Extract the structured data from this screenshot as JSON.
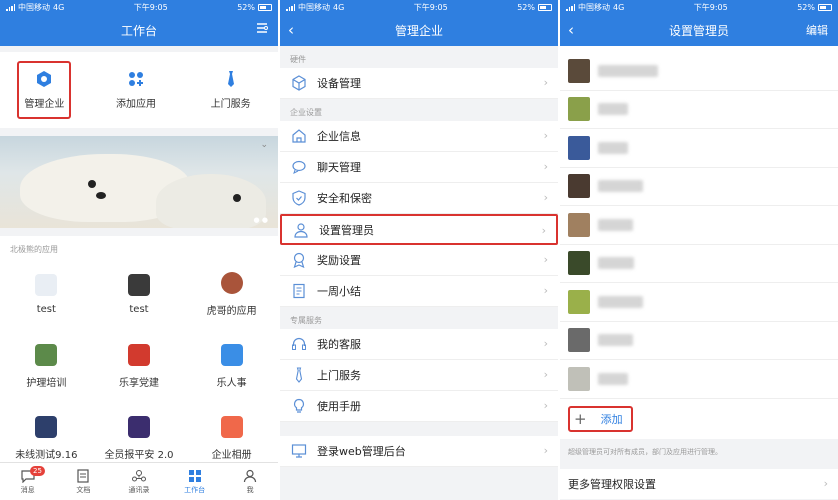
{
  "status": {
    "carrier": "中国移动",
    "network": "4G",
    "time": "下午9:05",
    "battery": "52%"
  },
  "panel1": {
    "title": "工作台",
    "shortcuts": [
      {
        "label": "管理企业",
        "icon": "hexagon-icon"
      },
      {
        "label": "添加应用",
        "icon": "apps-grid-icon"
      },
      {
        "label": "上门服务",
        "icon": "tie-icon"
      }
    ],
    "apps_section_title": "北极熊的应用",
    "apps": [
      {
        "label": "test",
        "color": "#e9eef4"
      },
      {
        "label": "test",
        "color": "#3a3a3a"
      },
      {
        "label": "虎哥的应用",
        "color": "#a9543a"
      },
      {
        "label": "护理培训",
        "color": "#5c8a4a"
      },
      {
        "label": "乐享党建",
        "color": "#d23a2e"
      },
      {
        "label": "乐人事",
        "color": "#3a8ee6"
      },
      {
        "label": "未线测试9.16",
        "color": "#2d3f6b"
      },
      {
        "label": "全员报平安 2.0",
        "color": "#3b2d6e"
      },
      {
        "label": "企业相册",
        "color": "#f0684a"
      }
    ],
    "tabs": [
      {
        "label": "消息",
        "icon": "chat-bubble-icon",
        "badge": "25"
      },
      {
        "label": "文档",
        "icon": "document-icon"
      },
      {
        "label": "通讯录",
        "icon": "contacts-icon"
      },
      {
        "label": "工作台",
        "icon": "workbench-grid-icon",
        "active": true
      },
      {
        "label": "我",
        "icon": "person-icon"
      }
    ]
  },
  "panel2": {
    "title": "管理企业",
    "sections": [
      {
        "title": "硬件",
        "rows": [
          {
            "label": "设备管理",
            "icon": "cube-icon"
          }
        ]
      },
      {
        "title": "企业设置",
        "rows": [
          {
            "label": "企业信息",
            "icon": "home-icon"
          },
          {
            "label": "聊天管理",
            "icon": "chat-icon"
          },
          {
            "label": "安全和保密",
            "icon": "shield-icon"
          },
          {
            "label": "设置管理员",
            "icon": "user-icon",
            "highlight": true
          },
          {
            "label": "奖励设置",
            "icon": "award-icon"
          },
          {
            "label": "一周小结",
            "icon": "report-icon"
          }
        ]
      },
      {
        "title": "专属服务",
        "rows": [
          {
            "label": "我的客服",
            "icon": "headset-icon"
          },
          {
            "label": "上门服务",
            "icon": "tie-icon"
          },
          {
            "label": "使用手册",
            "icon": "bulb-icon"
          }
        ]
      }
    ],
    "web_login": {
      "label": "登录web管理后台",
      "icon": "monitor-icon"
    }
  },
  "panel3": {
    "title": "设置管理员",
    "edit_label": "编辑",
    "members": [
      {
        "avatar_color": "#5a4a3a",
        "name_width": 60
      },
      {
        "avatar_color": "#8aa04a",
        "name_width": 30
      },
      {
        "avatar_color": "#3a5a9a",
        "name_width": 30
      },
      {
        "avatar_color": "#4a3a30",
        "name_width": 45
      },
      {
        "avatar_color": "#a08060",
        "name_width": 35
      },
      {
        "avatar_color": "#3a4a2a",
        "name_width": 36
      },
      {
        "avatar_color": "#9ab04a",
        "name_width": 45
      },
      {
        "avatar_color": "#6a6a6a",
        "name_width": 35
      },
      {
        "avatar_color": "#c0c0b8",
        "name_width": 30
      }
    ],
    "add_label": "添加",
    "hint": "超级管理员可对所有成员，部门及应用进行管理。",
    "more_label": "更多管理权限设置"
  }
}
